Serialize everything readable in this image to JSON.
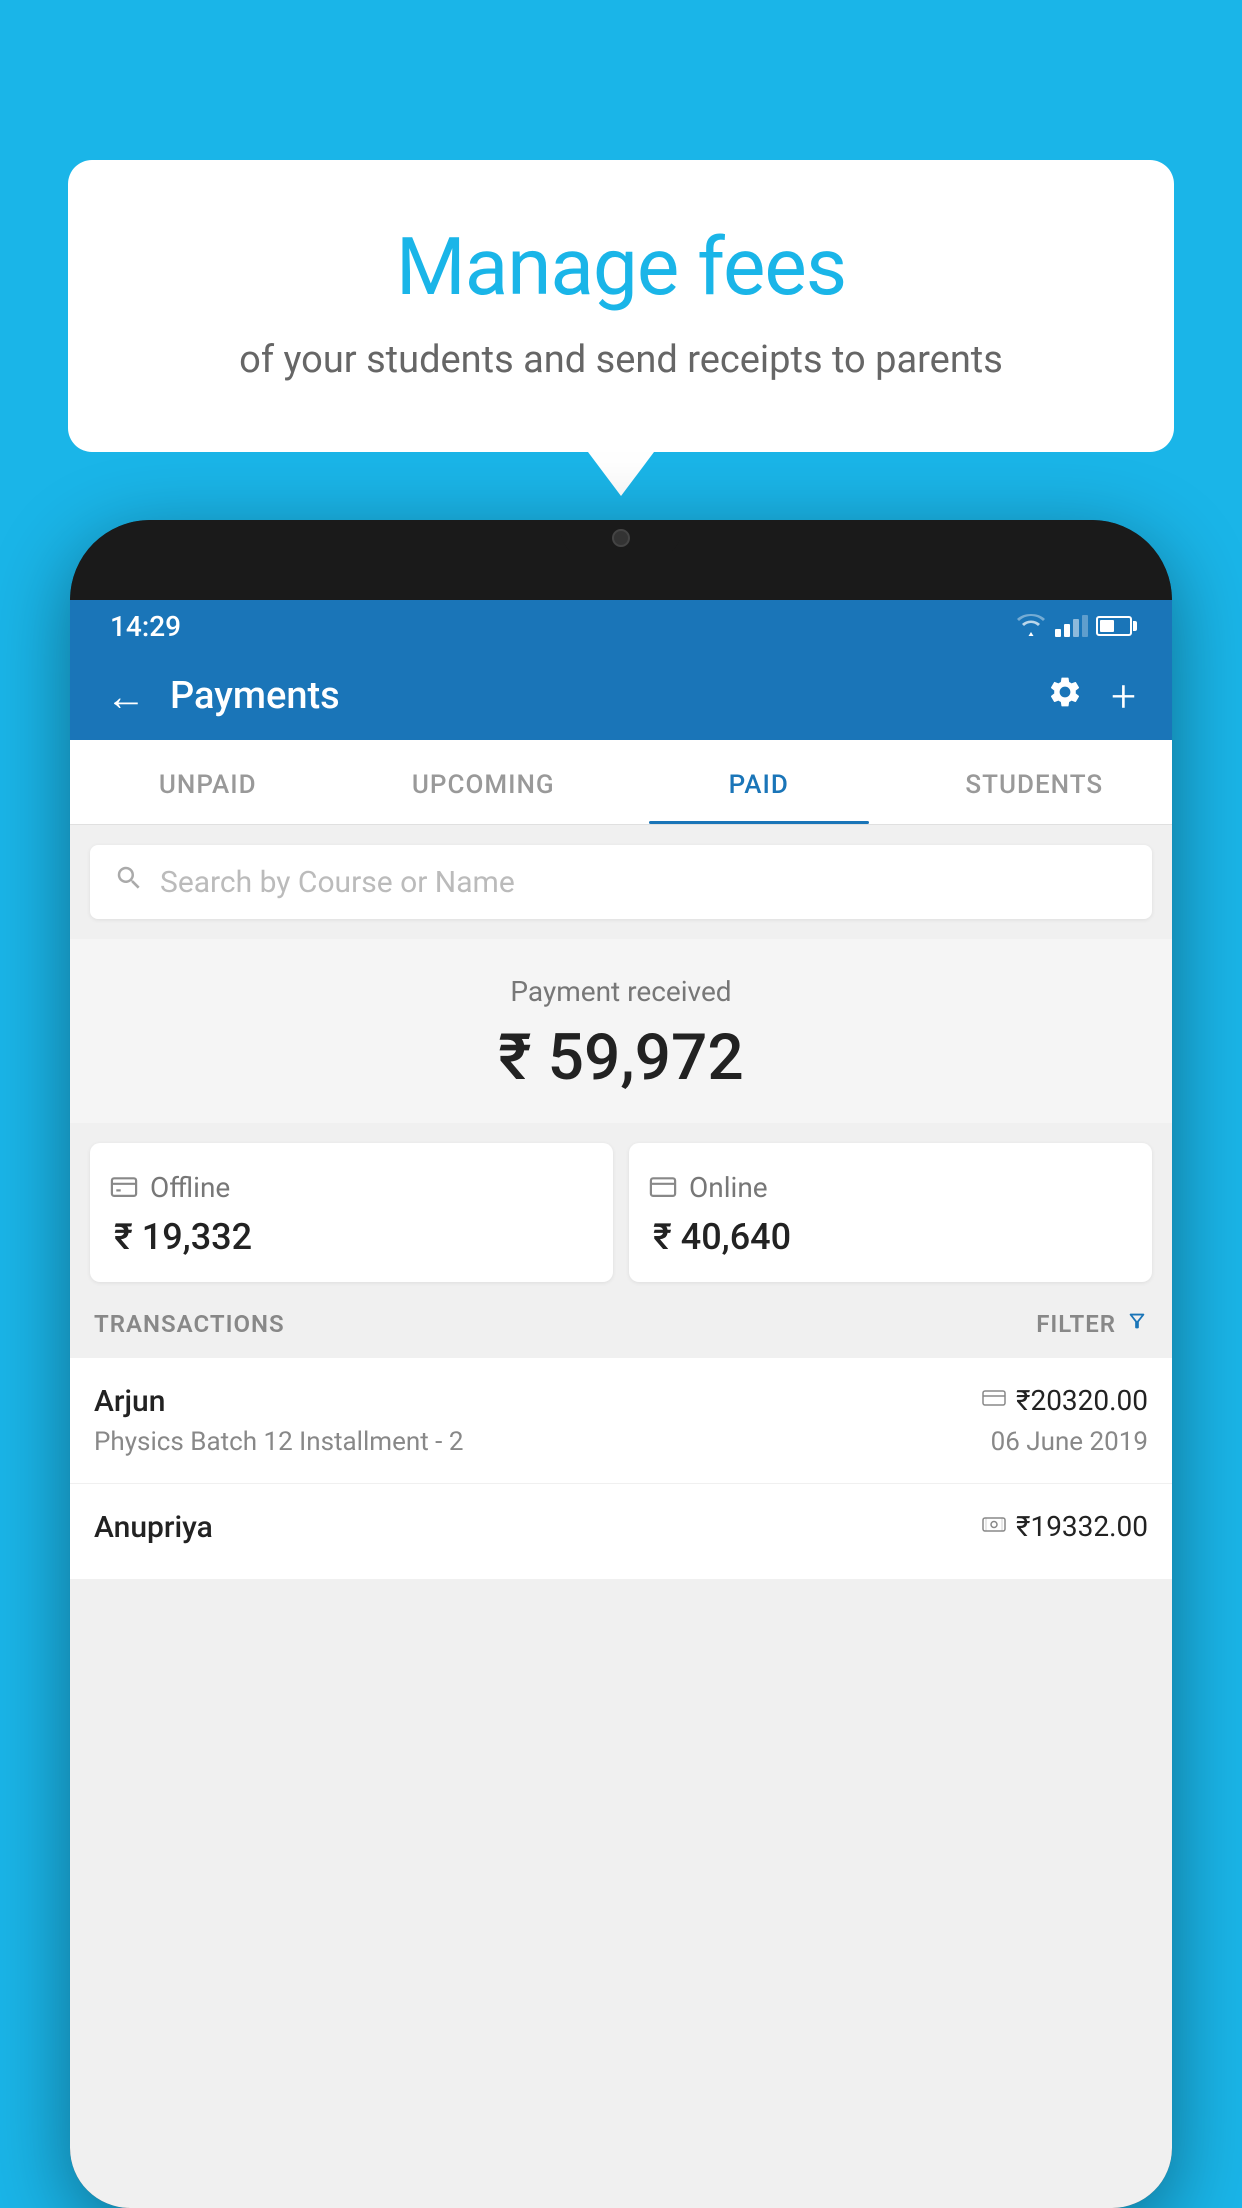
{
  "background_color": "#1ab5e8",
  "bubble": {
    "title": "Manage fees",
    "subtitle": "of your students and send receipts to parents"
  },
  "status_bar": {
    "time": "14:29"
  },
  "header": {
    "title": "Payments",
    "back_label": "←",
    "settings_label": "⚙",
    "add_label": "+"
  },
  "tabs": [
    {
      "label": "UNPAID",
      "active": false
    },
    {
      "label": "UPCOMING",
      "active": false
    },
    {
      "label": "PAID",
      "active": true
    },
    {
      "label": "STUDENTS",
      "active": false
    }
  ],
  "search": {
    "placeholder": "Search by Course or Name"
  },
  "payment_section": {
    "label": "Payment received",
    "total": "₹ 59,972",
    "offline": {
      "label": "Offline",
      "amount": "₹ 19,332"
    },
    "online": {
      "label": "Online",
      "amount": "₹ 40,640"
    }
  },
  "transactions": {
    "label": "TRANSACTIONS",
    "filter_label": "FILTER",
    "items": [
      {
        "name": "Arjun",
        "amount": "₹20320.00",
        "course": "Physics Batch 12 Installment - 2",
        "date": "06 June 2019",
        "icon": "card"
      },
      {
        "name": "Anupriya",
        "amount": "₹19332.00",
        "course": "",
        "date": "",
        "icon": "cash"
      }
    ]
  }
}
